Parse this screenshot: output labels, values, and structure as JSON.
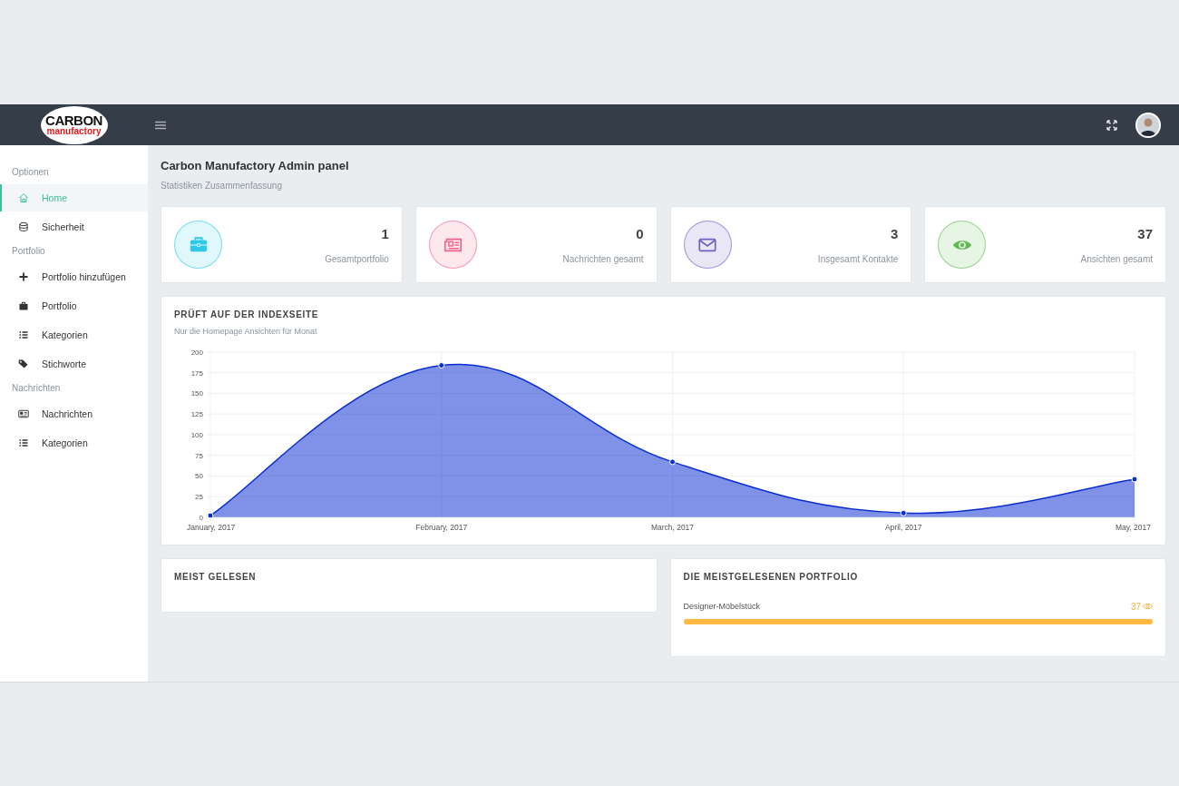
{
  "header": {
    "logo": {
      "line1": "CARBON",
      "line2": "manufactory"
    }
  },
  "sidebar": {
    "sections": [
      {
        "title": "Optionen",
        "items": [
          {
            "label": "Home",
            "selected": true
          },
          {
            "label": "Sicherheit",
            "selected": false
          }
        ]
      },
      {
        "title": "Portfolio",
        "items": [
          {
            "label": "Portfolio hinzufügen",
            "selected": false
          },
          {
            "label": "Portfolio",
            "selected": false
          },
          {
            "label": "Kategorien",
            "selected": false
          },
          {
            "label": "Stichworte",
            "selected": false
          }
        ]
      },
      {
        "title": "Nachrichten",
        "items": [
          {
            "label": "Nachrichten",
            "selected": false
          },
          {
            "label": "Kategorien",
            "selected": false
          }
        ]
      }
    ]
  },
  "page": {
    "title": "Carbon Manufactory Admin panel",
    "subtitle": "Statistiken Zusammenfassung"
  },
  "stats": [
    {
      "value": "1",
      "label": "Gesamtportfolio",
      "color": "#2fc9e8"
    },
    {
      "value": "0",
      "label": "Nachrichten gesamt",
      "color": "#f0628c"
    },
    {
      "value": "3",
      "label": "Insgesamt Kontakte",
      "color": "#6d5fc4"
    },
    {
      "value": "37",
      "label": "Ansichten gesamt",
      "color": "#5fba4f"
    }
  ],
  "chart_card": {
    "title": "PRÜFT AUF DER INDEXSEITE",
    "subtitle": "Nur die Homepage Ansichten für Monat",
    "chart_data": {
      "type": "area",
      "categories": [
        "January, 2017",
        "February, 2017",
        "March, 2017",
        "April, 2017",
        "May, 2017"
      ],
      "series": [
        {
          "color": "#0a2ed1",
          "values": [
            2,
            184,
            67,
            5,
            46
          ]
        }
      ],
      "grid": true,
      "ylim": [
        0,
        200
      ],
      "yticks": [
        0,
        25,
        50,
        75,
        100,
        125,
        150,
        175,
        200
      ]
    }
  },
  "most_read": {
    "title": "MEIST GELESEN"
  },
  "top_portfolio": {
    "title": "DIE MEISTGELESENEN PORTFOLIO",
    "items": [
      {
        "name": "Designer-Möbelstück",
        "count": "37",
        "level": 1.0
      }
    ]
  }
}
